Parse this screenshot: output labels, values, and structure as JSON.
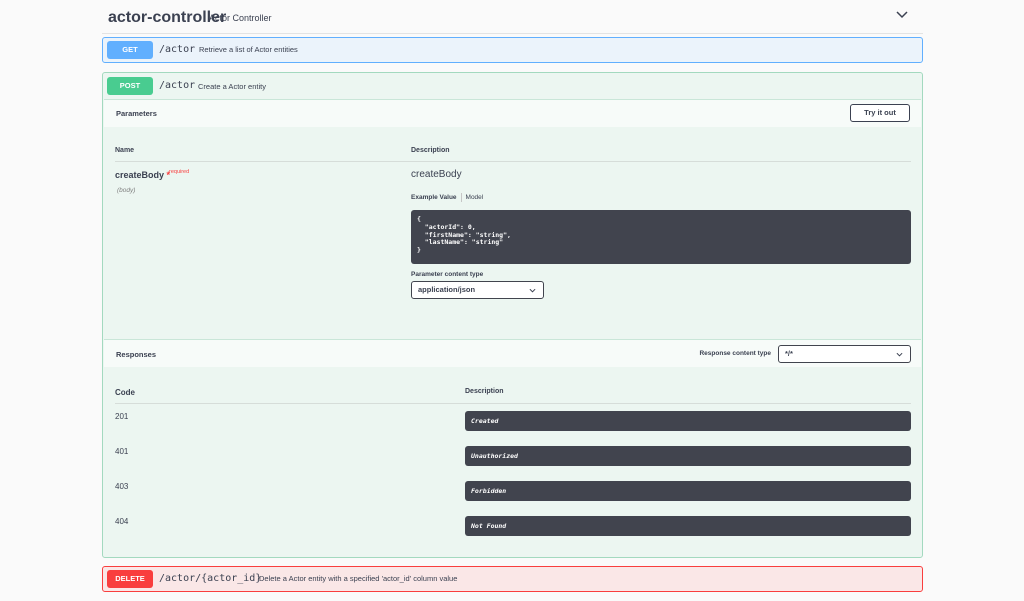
{
  "tag": {
    "name": "actor-controller",
    "description": "Actor Controller"
  },
  "operations": {
    "get": {
      "method": "GET",
      "path": "/actor",
      "summary": "Retrieve a list of Actor entities",
      "color": "#61affe"
    },
    "post": {
      "method": "POST",
      "path": "/actor",
      "summary": "Create a Actor entity",
      "color": "#49cc90",
      "parameters": {
        "title": "Parameters",
        "try_label": "Try it out",
        "col_name": "Name",
        "col_description": "Description",
        "param": {
          "name": "createBody",
          "required_star": "*",
          "required_label": "required",
          "in": "(body)",
          "description": "createBody"
        },
        "tabs": {
          "example": "Example Value",
          "model": "Model"
        },
        "example_json": "{\n  \"actorId\": 0,\n  \"firstName\": \"string\",\n  \"lastName\": \"string\"\n}",
        "content_type_label": "Parameter content type",
        "content_type_value": "application/json"
      },
      "responses": {
        "title": "Responses",
        "content_type_label": "Response content type",
        "content_type_value": "*/*",
        "col_code": "Code",
        "col_description": "Description",
        "rows": [
          {
            "code": "201",
            "description": "Created"
          },
          {
            "code": "401",
            "description": "Unauthorized"
          },
          {
            "code": "403",
            "description": "Forbidden"
          },
          {
            "code": "404",
            "description": "Not Found"
          }
        ]
      }
    },
    "delete": {
      "method": "DELETE",
      "path": "/actor/{actor_id}",
      "summary": "Delete a Actor entity with a specified 'actor_id' column value",
      "color": "#f93e3e"
    }
  }
}
